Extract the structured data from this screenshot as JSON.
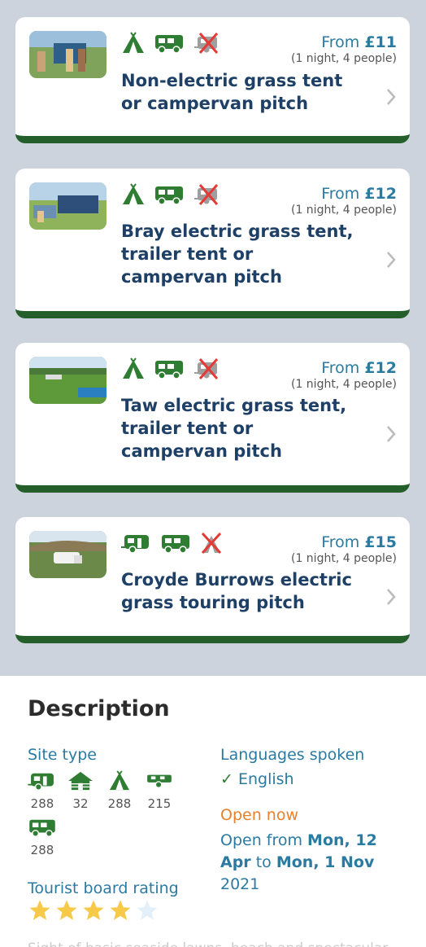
{
  "pitches": [
    {
      "from_label": "From ",
      "price": "£11",
      "per": "(1 night, 4 people)",
      "title": "Non-electric grass tent or campervan pitch",
      "icons": [
        "tent-icon",
        "campervan-icon",
        "no-caravan-icon"
      ]
    },
    {
      "from_label": "From ",
      "price": "£12",
      "per": "(1 night, 4 people)",
      "title": "Bray electric grass tent, trailer tent or campervan pitch",
      "icons": [
        "tent-icon",
        "campervan-icon",
        "no-caravan-icon"
      ]
    },
    {
      "from_label": "From ",
      "price": "£12",
      "per": "(1 night, 4 people)",
      "title": "Taw electric grass tent, trailer tent or campervan pitch",
      "icons": [
        "tent-icon",
        "campervan-icon",
        "no-caravan-icon"
      ]
    },
    {
      "from_label": "From ",
      "price": "£15",
      "per": "(1 night, 4 people)",
      "title": "Croyde Burrows electric grass touring pitch",
      "icons": [
        "caravan-icon",
        "campervan-icon",
        "no-tent-icon"
      ]
    }
  ],
  "description": {
    "heading": "Description",
    "site_type_label": "Site type",
    "site_types": [
      {
        "icon": "caravan-icon",
        "count": "288"
      },
      {
        "icon": "lodge-icon",
        "count": "32"
      },
      {
        "icon": "tent-icon",
        "count": "288"
      },
      {
        "icon": "trailer-tent-icon",
        "count": "215"
      },
      {
        "icon": "campervan-icon",
        "count": "288"
      }
    ],
    "languages_label": "Languages spoken",
    "language": "English",
    "open_status": "Open now",
    "open_from_prefix": "Open from ",
    "open_start": "Mon, 12 Apr",
    "open_to": " to ",
    "open_end": "Mon, 1 Nov",
    "open_year": " 2021",
    "rating_label": "Tourist board rating",
    "rating": 4,
    "rating_max": 5,
    "faded_text": "Sight of basic seaside lawns, beach and spectacular..."
  },
  "colors": {
    "accent": "#2b7aa1",
    "brand_green": "#245e2b",
    "title": "#1e3f66",
    "open_now": "#e8812c",
    "star": "#f7c948"
  }
}
